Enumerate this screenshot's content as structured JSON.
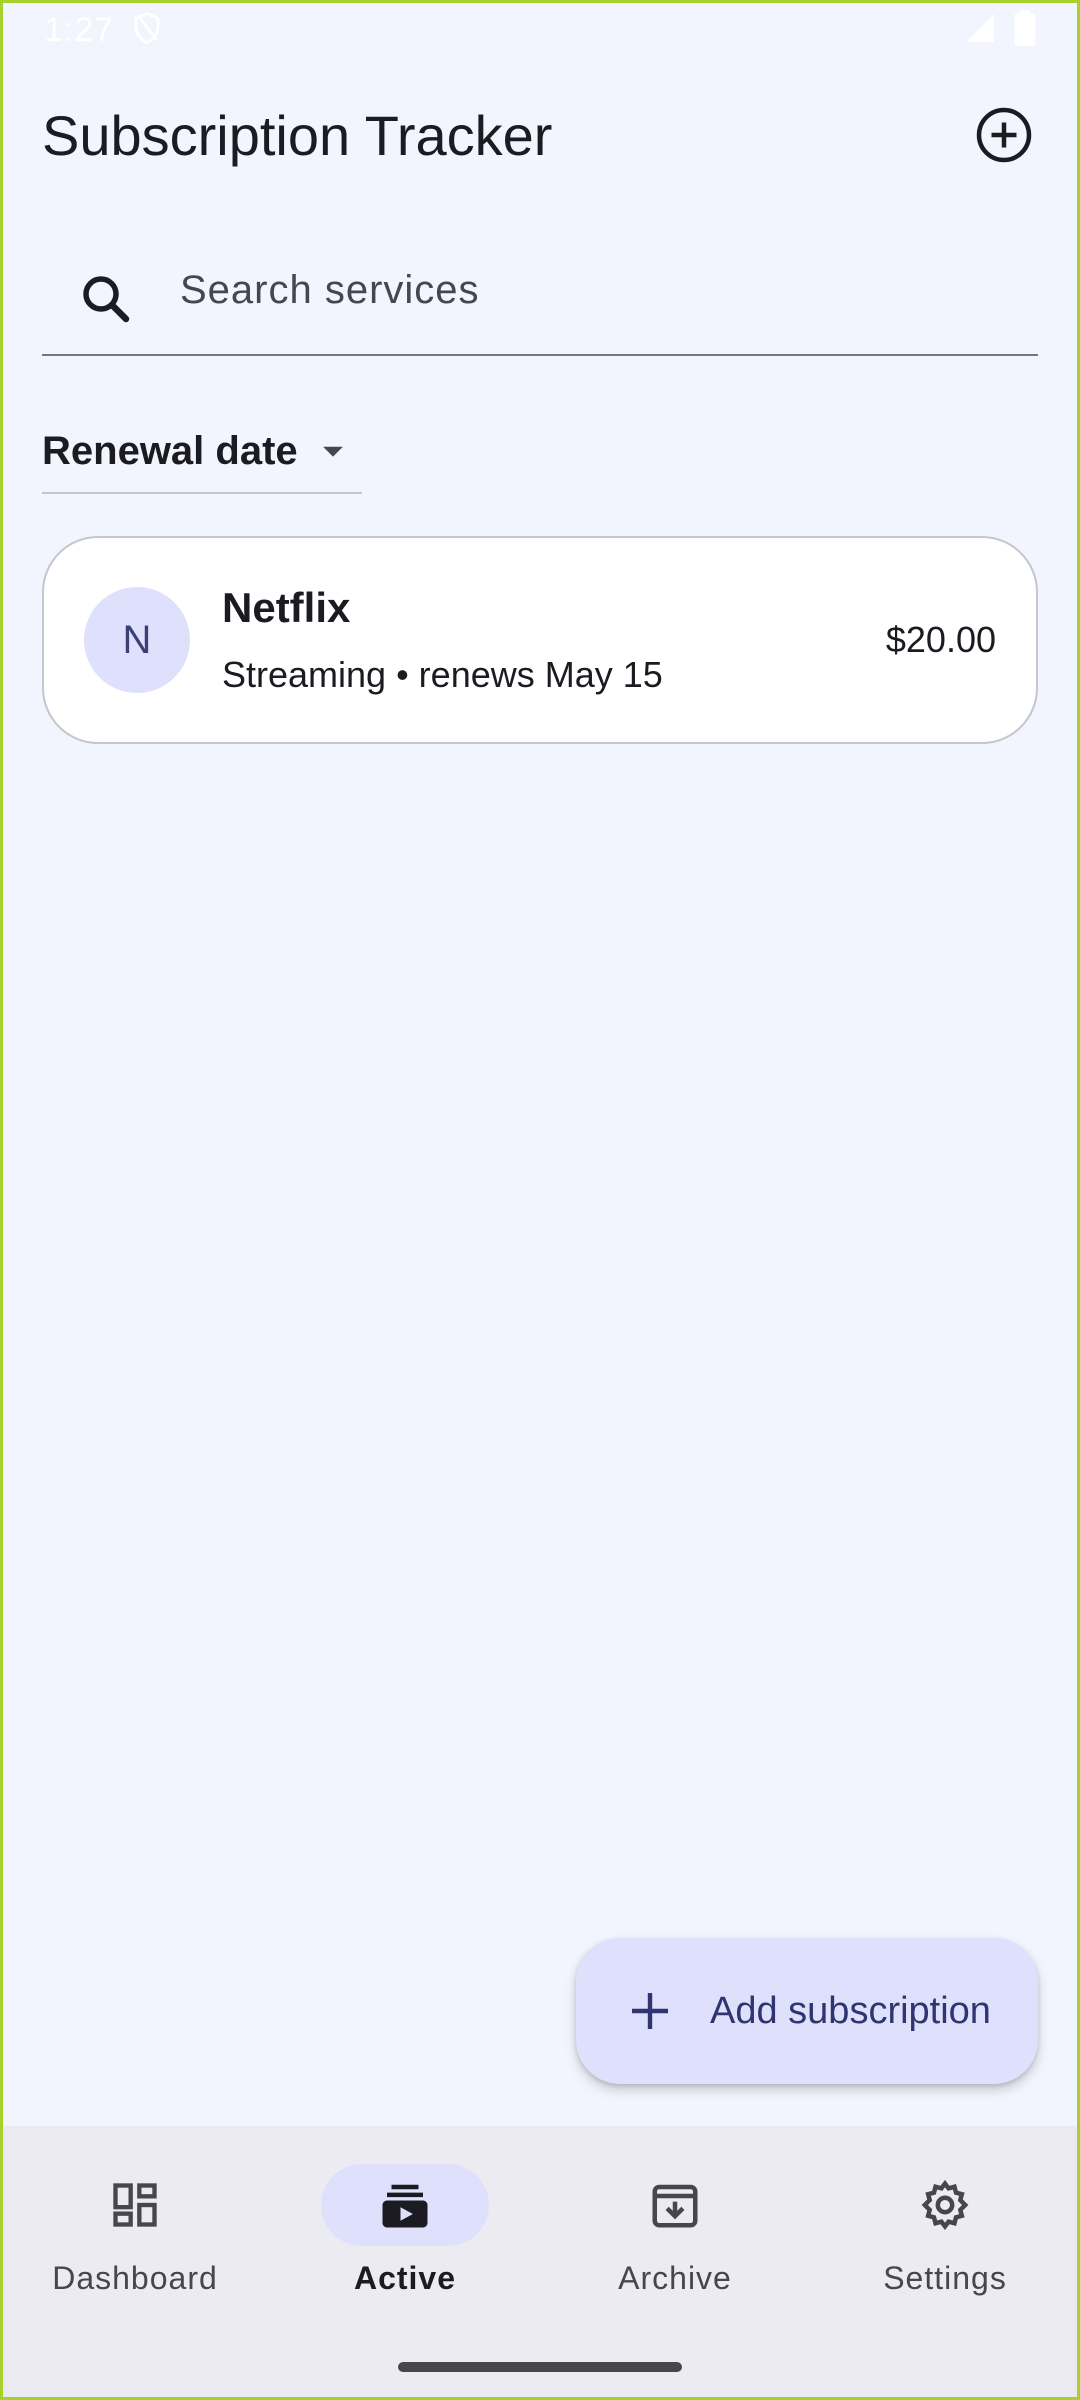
{
  "status_bar": {
    "time": "1:27"
  },
  "app_bar": {
    "title": "Subscription Tracker"
  },
  "search": {
    "placeholder": "Search services",
    "value": ""
  },
  "sort": {
    "label": "Renewal date"
  },
  "subscriptions": [
    {
      "initial": "N",
      "name": "Netflix",
      "subtitle": "Streaming • renews May 15",
      "price": "$20.00"
    }
  ],
  "fab": {
    "label": "Add subscription"
  },
  "bottom_nav": {
    "items": [
      {
        "label": "Dashboard",
        "icon": "dashboard-icon",
        "active": false
      },
      {
        "label": "Active",
        "icon": "subscriptions-icon",
        "active": true
      },
      {
        "label": "Archive",
        "icon": "archive-icon",
        "active": false
      },
      {
        "label": "Settings",
        "icon": "gear-icon",
        "active": false
      }
    ]
  },
  "colors": {
    "background": "#f3f5fe",
    "accent_container": "#dfe0fb",
    "on_accent": "#2e3570",
    "nav_background": "#ecebf1"
  }
}
